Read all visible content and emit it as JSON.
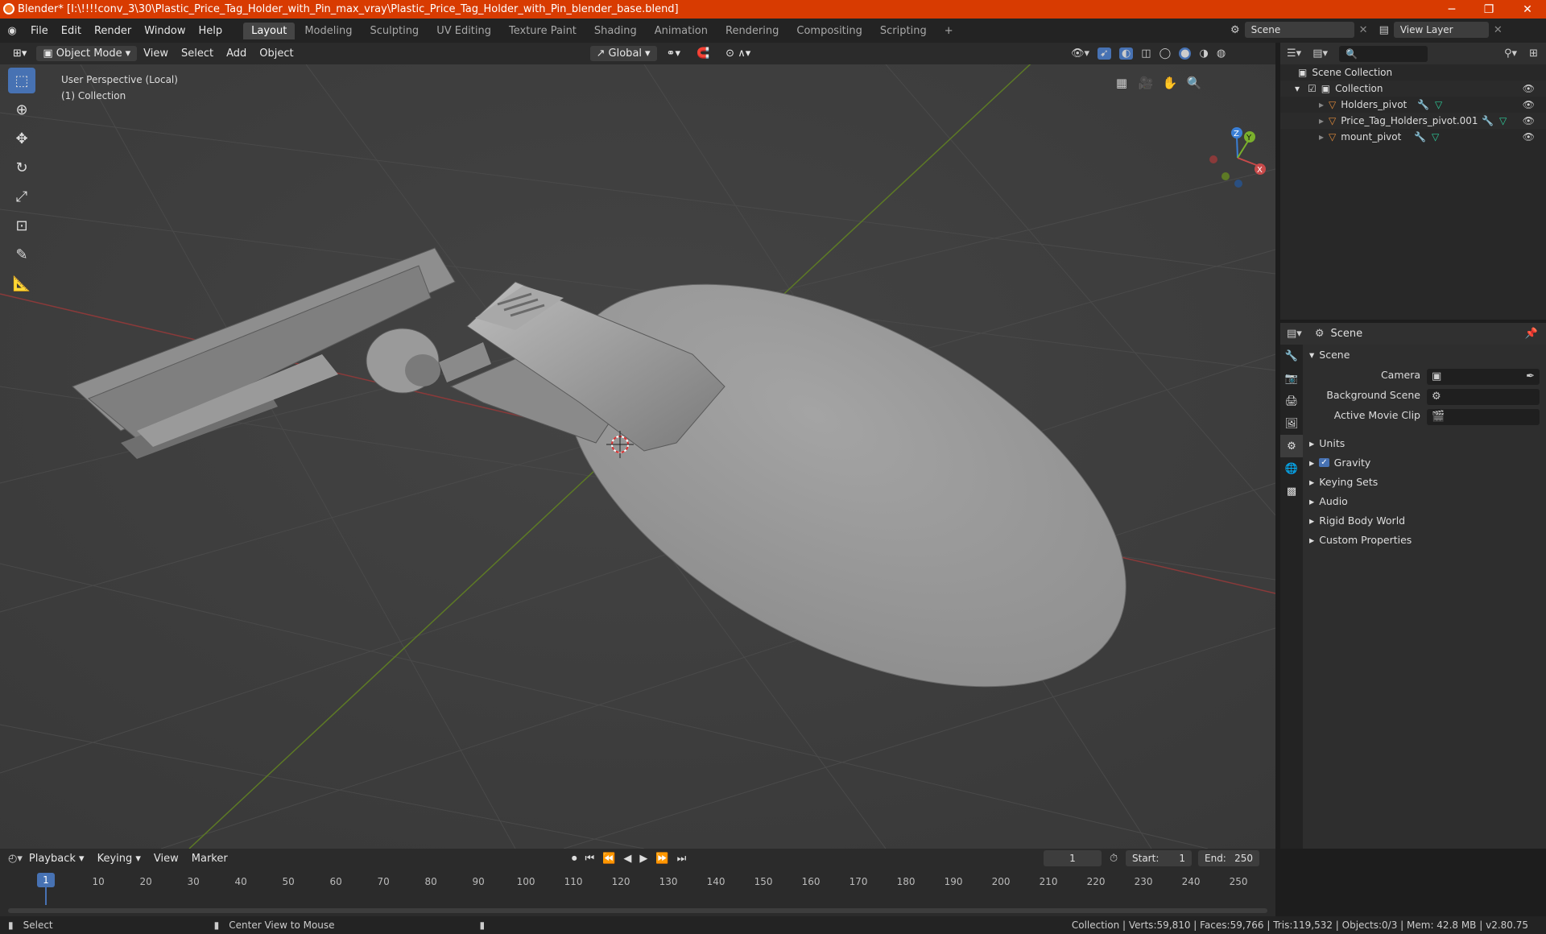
{
  "window": {
    "title": "Blender* [I:\\!!!!conv_3\\30\\Plastic_Price_Tag_Holder_with_Pin_max_vray\\Plastic_Price_Tag_Holder_with_Pin_blender_base.blend]",
    "minimize": "─",
    "maximize": "❐",
    "close": "✕"
  },
  "menu": [
    "File",
    "Edit",
    "Render",
    "Window",
    "Help"
  ],
  "workspaces": [
    "Layout",
    "Modeling",
    "Sculpting",
    "UV Editing",
    "Texture Paint",
    "Shading",
    "Animation",
    "Rendering",
    "Compositing",
    "Scripting"
  ],
  "scene_field": "Scene",
  "view_layer_field": "View Layer",
  "viewport_header": {
    "mode": "Object Mode",
    "menus": [
      "View",
      "Select",
      "Add",
      "Object"
    ],
    "orientation": "Global"
  },
  "viewport": {
    "perspective": "User Perspective (Local)",
    "collection": "(1) Collection",
    "gizmo": {
      "x": "X",
      "y": "Y",
      "z": "Z"
    }
  },
  "outliner": {
    "scene_collection": "Scene Collection",
    "collection": "Collection",
    "items": [
      "Holders_pivot",
      "Price_Tag_Holders_pivot.001",
      "mount_pivot"
    ]
  },
  "properties": {
    "header": "Scene",
    "panel": "Scene",
    "camera_label": "Camera",
    "background_scene_label": "Background Scene",
    "active_movie_clip_label": "Active Movie Clip",
    "sections": [
      "Units",
      "Gravity",
      "Keying Sets",
      "Audio",
      "Rigid Body World",
      "Custom Properties"
    ]
  },
  "timeline": {
    "menus": [
      "Playback",
      "Keying",
      "View",
      "Marker"
    ],
    "current_frame": "1",
    "start_label": "Start:",
    "start": "1",
    "end_label": "End:",
    "end": "250",
    "ticks": [
      "1",
      "10",
      "20",
      "30",
      "40",
      "50",
      "60",
      "70",
      "80",
      "90",
      "100",
      "110",
      "120",
      "130",
      "140",
      "150",
      "160",
      "170",
      "180",
      "190",
      "200",
      "210",
      "220",
      "230",
      "240",
      "250"
    ]
  },
  "statusbar": {
    "select": "Select",
    "center": "Center View to Mouse",
    "stats": "Collection | Verts:59,810 | Faces:59,766 | Tris:119,532 | Objects:0/3 | Mem: 42.8 MB | v2.80.75"
  },
  "colors": {
    "accent": "#4772b3",
    "titlebar": "#d83b01",
    "x_axis": "#c84a4a",
    "y_axis": "#7ab02c",
    "z_axis": "#3a7fd6"
  }
}
